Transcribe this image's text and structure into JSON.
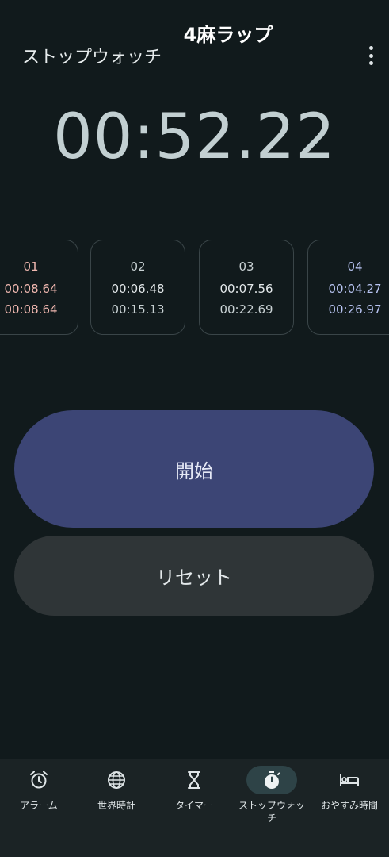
{
  "overlay": {
    "title": "4麻ラップ"
  },
  "header": {
    "title": "ストップウォッチ",
    "menu_icon": "more-vert-icon"
  },
  "stopwatch": {
    "time": "00:52.22"
  },
  "laps": [
    {
      "number": "01",
      "split": "00:08.64",
      "total": "00:08.64",
      "state": "slowest"
    },
    {
      "number": "02",
      "split": "00:06.48",
      "total": "00:15.13",
      "state": "normal"
    },
    {
      "number": "03",
      "split": "00:07.56",
      "total": "00:22.69",
      "state": "normal"
    },
    {
      "number": "04",
      "split": "00:04.27",
      "total": "00:26.97",
      "state": "fastest"
    }
  ],
  "buttons": {
    "start_label": "開始",
    "reset_label": "リセット"
  },
  "nav": {
    "items": [
      {
        "label": "アラーム",
        "icon": "alarm-icon"
      },
      {
        "label": "世界時計",
        "icon": "globe-icon"
      },
      {
        "label": "タイマー",
        "icon": "hourglass-icon"
      },
      {
        "label": "ストップウォッチ",
        "icon": "stopwatch-icon",
        "active": true
      },
      {
        "label": "おやすみ時間",
        "icon": "bed-icon"
      }
    ]
  },
  "colors": {
    "background": "#111a1c",
    "start_button": "#3c4575",
    "reset_button": "#2f3537",
    "slowest_lap": "#f1b8b0",
    "fastest_lap": "#b8c4f2",
    "nav_active": "#2e4347"
  }
}
